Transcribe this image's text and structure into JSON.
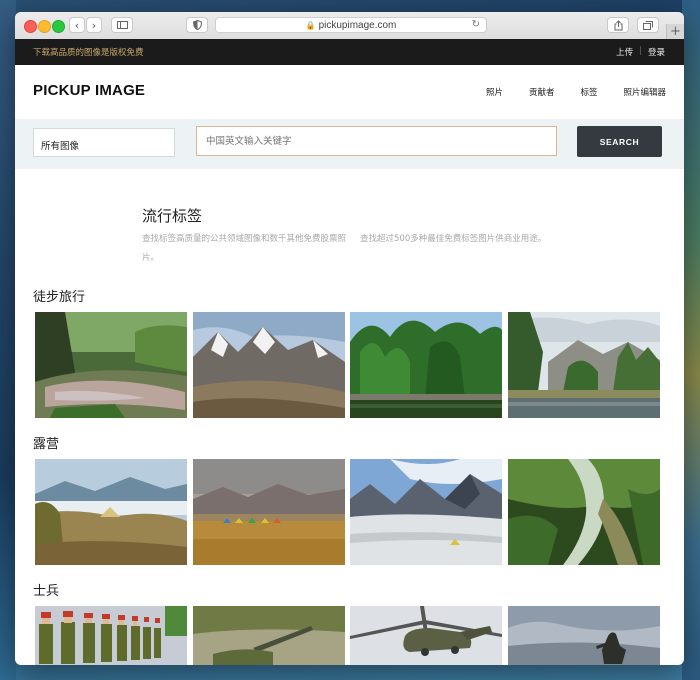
{
  "browser": {
    "url": "pickupimage.com"
  },
  "topbar": {
    "promo": "下载高品质的图像是版权免费",
    "links": [
      "上传",
      "登录"
    ]
  },
  "header": {
    "logo": "PICKUP IMAGE",
    "nav": [
      "照片",
      "贡献者",
      "标签",
      "照片编辑器"
    ]
  },
  "search": {
    "select_value": "所有图像",
    "placeholder": "中国英文输入关键字",
    "button_label": "SEARCH"
  },
  "popular_tags": {
    "title": "流行标签",
    "desc_left": "查找标签高质量的公共领域图像和数千其他免费股票照片。",
    "desc_right": "查找超过500多种最佳免费标签图片供商业用途。"
  },
  "sections": [
    {
      "title": "徒步旅行",
      "photos": [
        "river-forest-photo",
        "snowy-mountain-photo",
        "forest-lake-photo",
        "valley-lake-photo"
      ]
    },
    {
      "title": "露营",
      "photos": [
        "hill-tent-photo",
        "desert-tents-photo",
        "glacier-camp-photo",
        "jungle-trail-photo"
      ]
    },
    {
      "title": "士兵",
      "photos": [
        "honor-guard-photo",
        "field-artillery-photo",
        "helicopter-photo",
        "soldier-silhouette-photo"
      ]
    }
  ],
  "colors": {
    "topbar_bg": "#1b1b1b",
    "promo_text": "#c8a86b",
    "search_button": "#343a40",
    "search_border": "#d8b893",
    "searchbar_bg": "#edf2f4"
  }
}
